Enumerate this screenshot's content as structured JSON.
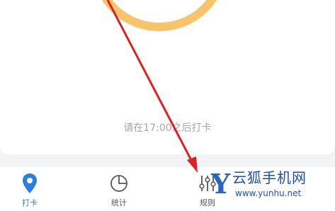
{
  "main": {
    "hint": "请在17:00之后打卡"
  },
  "tabbar": {
    "items": [
      {
        "label": "打卡",
        "icon": "location-pin-icon",
        "active": true
      },
      {
        "label": "统计",
        "icon": "pie-chart-icon",
        "active": false
      },
      {
        "label": "规则",
        "icon": "sliders-icon",
        "active": false
      }
    ]
  },
  "watermark": {
    "letter": "Y",
    "name": "云狐手机网",
    "url": "www.yunhu.net"
  },
  "colors": {
    "accent": "#2a7de1",
    "ring": "#f7c46c",
    "arrow": "#e02020",
    "watermark": "#1e4fb0"
  }
}
